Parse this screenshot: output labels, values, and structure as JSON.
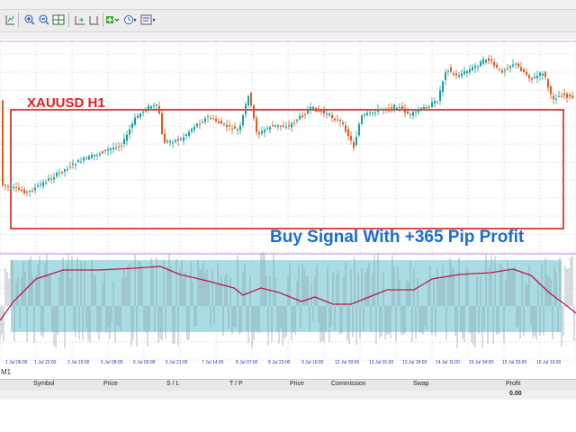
{
  "toolbar": {
    "icons": [
      "chart-bar-icon",
      "zoom-in-icon",
      "zoom-out-icon",
      "tile-windows-icon",
      "auto-scroll-icon",
      "chart-shift-icon",
      "add-indicator-icon",
      "period-icon",
      "templates-icon"
    ]
  },
  "chart": {
    "symbol_label": "XAUUSD H1",
    "signal_text": "Buy Signal With +365 Pip Profit",
    "colors": {
      "bull": "#1a9fa0",
      "bear": "#e05a1c",
      "grid": "#c8c8c8",
      "signal_box": "#d61e1e",
      "signal_text": "#1a6fcf",
      "indicator_band": "#a9dde3",
      "indicator_line": "#c0184a",
      "histogram": "#8a9aa8",
      "divider": "#c8a0e0"
    },
    "time_labels": [
      "1 Jul 06:00",
      "1 Jul 22:00",
      "2 Jul 15:00",
      "5 Jul 08:00",
      "6 Jul 00:00",
      "6 Jul 21:00",
      "7 Jul 14:00",
      "8 Jul 07:00",
      "8 Jul 23:00",
      "9 Jul 16:00",
      "12 Jul 09:00",
      "13 Jul 01:00",
      "13 Jul 18:00",
      "14 Jul 11:00",
      "15 Jul 04:00",
      "15 Jul 20:00",
      "16 Jul 13:00"
    ]
  },
  "terminal": {
    "tab": "M1",
    "columns": [
      "Symbol",
      "Price",
      "S / L",
      "T / P",
      "Price",
      "Commission",
      "Swap",
      "Profit"
    ],
    "profit_total": "0.00"
  }
}
